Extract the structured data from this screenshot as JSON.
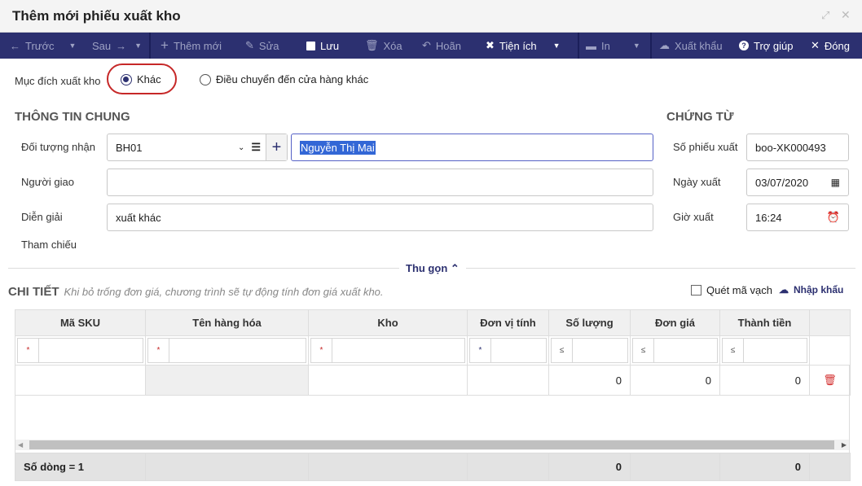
{
  "window": {
    "title": "Thêm mới phiếu xuất kho"
  },
  "toolbar": {
    "prev": "Trước",
    "next": "Sau",
    "add": "Thêm mới",
    "edit": "Sửa",
    "save": "Lưu",
    "delete": "Xóa",
    "undo": "Hoãn",
    "utilities": "Tiện ích",
    "print": "In",
    "export": "Xuất khẩu",
    "help": "Trợ giúp",
    "close": "Đóng"
  },
  "purpose": {
    "label": "Mục đích xuất kho",
    "options": [
      "Khác",
      "Điều chuyển đến cửa hàng khác"
    ],
    "selected": "Khác"
  },
  "general": {
    "heading": "THÔNG TIN CHUNG",
    "recipient_label": "Đối tượng nhận",
    "recipient_code": "BH01",
    "recipient_name": "Nguyễn Thị Mai",
    "deliverer_label": "Người giao",
    "deliverer": "",
    "description_label": "Diễn giải",
    "description": "xuất khác",
    "reference_label": "Tham chiếu"
  },
  "voucher": {
    "heading": "CHỨNG TỪ",
    "number_label": "Số phiếu xuất",
    "number": "boo-XK000493",
    "date_label": "Ngày xuất",
    "date": "03/07/2020",
    "time_label": "Giờ xuất",
    "time": "16:24"
  },
  "collapse": "Thu gọn",
  "detail": {
    "heading": "CHI TIẾT",
    "hint": "Khi bỏ trống đơn giá, chương trình sẽ tự động tính đơn giá xuất kho.",
    "barcode": "Quét mã vạch",
    "import": "Nhập khẩu",
    "columns": [
      "Mã SKU",
      "Tên hàng hóa",
      "Kho",
      "Đơn vị tính",
      "Số lượng",
      "Đơn giá",
      "Thành tiền"
    ],
    "filters": [
      "*",
      "*",
      "*",
      "*",
      "≤",
      "≤",
      "≤"
    ],
    "row": {
      "sku": "",
      "name": "",
      "warehouse": "",
      "unit": "",
      "qty": "0",
      "price": "0",
      "amount": "0"
    },
    "footer": {
      "count": "Số dòng = 1",
      "qty": "0",
      "amount": "0"
    }
  },
  "colors": {
    "toolbar": "#2c3070",
    "highlight": "#c62828"
  }
}
